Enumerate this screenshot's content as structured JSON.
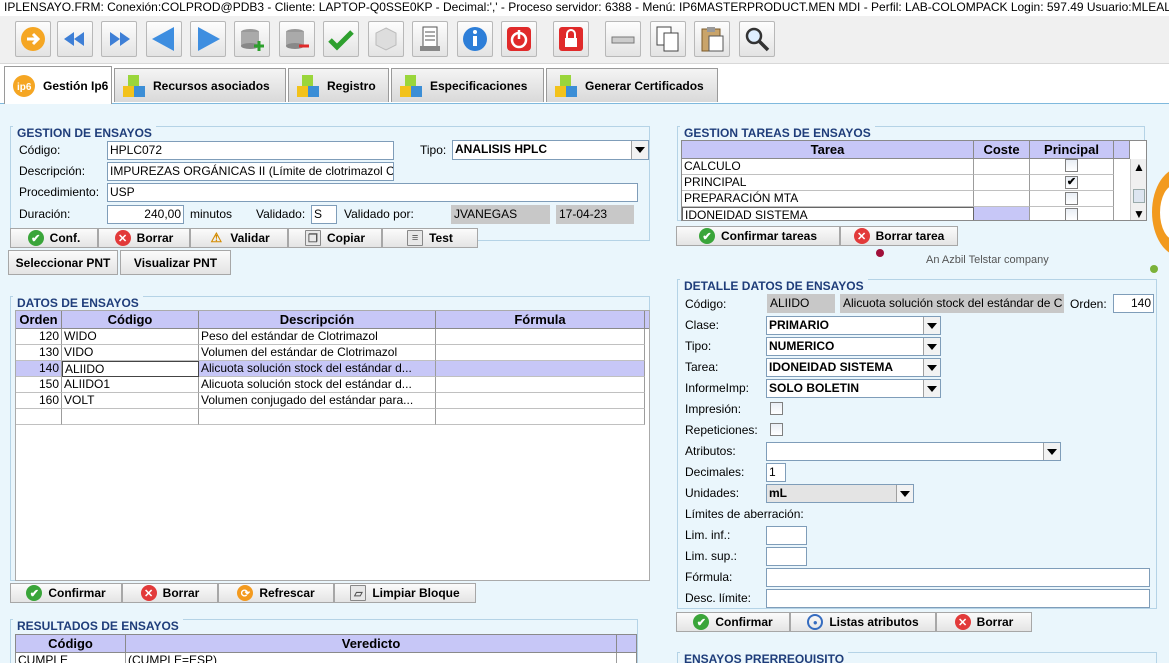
{
  "titlebar": {
    "text": "IPLENSAYO.FRM:      Conexión:COLPROD@PDB3 - Cliente: LAPTOP-Q0SSE0KP - Decimal:',' - Proceso servidor: 6388 - Menú: IP6MASTERPRODUCT.MEN MDI - Perfil: LAB-COLOMPACK Login: 597.49        Usuario:MLEAL"
  },
  "toolbar": {
    "buttons": [
      "enter-icon",
      "rewind-icon",
      "fast-forward-icon",
      "previous-icon",
      "next-icon",
      "database-add-icon",
      "database-remove-icon",
      "checkmark-icon",
      "cube-icon",
      "printer-icon",
      "info-icon",
      "power-icon",
      "lock-icon",
      "tray-icon",
      "copy-icon",
      "paste-icon",
      "search-icon"
    ]
  },
  "tabs": [
    {
      "label": "Gestión Ip6",
      "icon": "ip6-logo-icon"
    },
    {
      "label": "Recursos asociados",
      "icon": "cubes-icon"
    },
    {
      "label": "Registro",
      "icon": "cubes-icon"
    },
    {
      "label": "Especificaciones",
      "icon": "cubes-icon"
    },
    {
      "label": "Generar Certificados",
      "icon": "cubes-icon"
    }
  ],
  "gestion": {
    "title": "GESTION DE ENSAYOS",
    "codigo_label": "Código:",
    "codigo": "HPLC072",
    "tipo_label": "Tipo:",
    "tipo": "ANALISIS HPLC",
    "descripcion_label": "Descripción:",
    "descripcion": "IMPUREZAS ORGÁNICAS II (Límite de clotrimazol C",
    "procedimiento_label": "Procedimiento:",
    "procedimiento": "USP",
    "duracion_label": "Duración:",
    "duracion": "240,00",
    "minutos": "minutos",
    "validado_label": "Validado:",
    "validado": "S",
    "validado_por_label": "Validado por:",
    "validado_por": "JVANEGAS",
    "fecha": "17-04-23",
    "btn_conf": "Conf.",
    "btn_borrar": "Borrar",
    "btn_validar": "Validar",
    "btn_copiar": "Copiar",
    "btn_test": "Test",
    "btn_seleccionar": "Seleccionar PNT",
    "btn_visualizar": "Visualizar PNT"
  },
  "tareas": {
    "title": "GESTION TAREAS DE ENSAYOS",
    "headers": [
      "Tarea",
      "Coste",
      "Principal"
    ],
    "rows": [
      {
        "tarea": "CALCULO",
        "checked": false
      },
      {
        "tarea": "PRINCIPAL",
        "checked": true
      },
      {
        "tarea": "PREPARACIÓN MTA",
        "checked": false
      },
      {
        "tarea": "IDONEIDAD SISTEMA",
        "checked": false
      }
    ],
    "btn_confirmar": "Confirmar tareas",
    "btn_borrar": "Borrar tarea",
    "company": "An Azbil Telstar company"
  },
  "datos": {
    "title": "DATOS DE ENSAYOS",
    "headers": [
      "Orden",
      "Código",
      "Descripción",
      "Fórmula"
    ],
    "rows": [
      {
        "orden": "120",
        "codigo": "WIDO",
        "descripcion": "Peso del estándar de Clotrimazol"
      },
      {
        "orden": "130",
        "codigo": "VIDO",
        "descripcion": "Volumen del estándar de Clotrimazol"
      },
      {
        "orden": "140",
        "codigo": "ALIIDO",
        "descripcion": "Alicuota solución stock del estándar d..."
      },
      {
        "orden": "150",
        "codigo": "ALIIDO1",
        "descripcion": "Alicuota solución stock del estándar d..."
      },
      {
        "orden": "160",
        "codigo": "VOLT",
        "descripcion": "Volumen conjugado del estándar para..."
      }
    ],
    "btn_confirmar": "Confirmar",
    "btn_borrar": "Borrar",
    "btn_refrescar": "Refrescar",
    "btn_limpiar": "Limpiar Bloque"
  },
  "detalle": {
    "title": "DETALLE DATOS DE ENSAYOS",
    "codigo_label": "Código:",
    "codigo": "ALIIDO",
    "codigo_desc": "Alicuota solución stock del estándar de C",
    "orden_label": "Orden:",
    "orden": "140",
    "clase_label": "Clase:",
    "clase": "PRIMARIO",
    "tipo_label": "Tipo:",
    "tipo": "NUMERICO",
    "tarea_label": "Tarea:",
    "tarea": "IDONEIDAD SISTEMA",
    "informe_label": "InformeImp:",
    "informe": "SOLO BOLETIN",
    "impresion_label": "Impresión:",
    "repeticiones_label": "Repeticiones:",
    "atributos_label": "Atributos:",
    "decimales_label": "Decimales:",
    "decimales": "1",
    "unidades_label": "Unidades:",
    "unidades": "mL",
    "limites_label": "Límites de aberración:",
    "lim_inf_label": "Lim. inf.:",
    "lim_sup_label": "Lim. sup.:",
    "formula_label": "Fórmula:",
    "desc_limite_label": "Desc. límite:",
    "btn_confirmar": "Confirmar",
    "btn_listas": "Listas atributos",
    "btn_borrar": "Borrar"
  },
  "resultados": {
    "title": "RESULTADOS DE ENSAYOS",
    "headers": [
      "Código",
      "Veredicto"
    ],
    "row_codigo": "CUMPLE",
    "row_veredicto": "(CUMPLE=ESP)"
  },
  "prerrequisito": {
    "title": "ENSAYOS PRERREQUISITO"
  }
}
